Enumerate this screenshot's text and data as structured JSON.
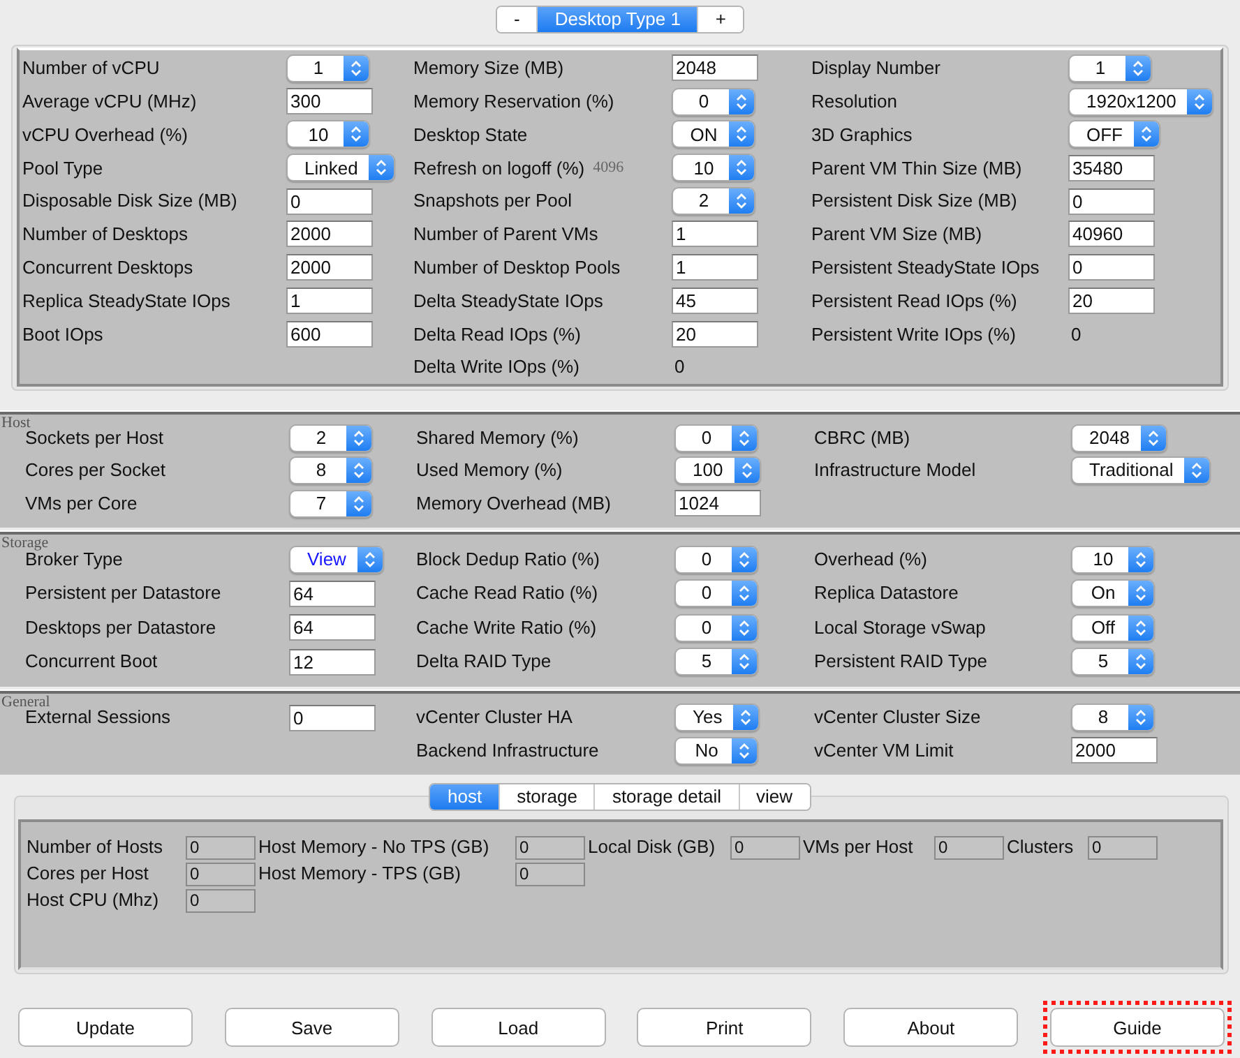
{
  "desktop_tabs": [
    {
      "label": "-",
      "selected": false
    },
    {
      "label": "Desktop Type 1",
      "selected": true
    },
    {
      "label": "+",
      "selected": false
    }
  ],
  "desktop_type": {
    "columns": [
      [
        {
          "label": "Number of vCPU",
          "kind": "select",
          "value": "1"
        },
        {
          "label": "Average vCPU (MHz)",
          "kind": "text",
          "value": "300"
        },
        {
          "label": "vCPU Overhead (%)",
          "kind": "select",
          "value": "10"
        },
        {
          "label": "Pool Type",
          "kind": "select",
          "value": "Linked"
        },
        {
          "label": "Disposable Disk Size (MB)",
          "kind": "text",
          "value": "0"
        },
        {
          "label": "Number of Desktops",
          "kind": "text",
          "value": "2000"
        },
        {
          "label": "Concurrent Desktops",
          "kind": "text",
          "value": "2000"
        },
        {
          "label": "Replica SteadyState IOps",
          "kind": "text",
          "value": "1"
        },
        {
          "label": "Boot IOps",
          "kind": "text",
          "value": "600"
        }
      ],
      [
        {
          "label": "Memory Size (MB)",
          "kind": "text",
          "value": "2048"
        },
        {
          "label": "Memory Reservation (%)",
          "kind": "select",
          "value": "0"
        },
        {
          "label": "Desktop State",
          "kind": "select",
          "value": "ON"
        },
        {
          "label": "Refresh on logoff (%)",
          "kind": "select",
          "value": "10",
          "note": "4096"
        },
        {
          "label": "Snapshots per Pool",
          "kind": "select",
          "value": "2"
        },
        {
          "label": "Number of Parent VMs",
          "kind": "text",
          "value": "1"
        },
        {
          "label": "Number of Desktop Pools",
          "kind": "text",
          "value": "1"
        },
        {
          "label": "Delta SteadyState IOps",
          "kind": "text",
          "value": "45"
        },
        {
          "label": "Delta Read IOps (%)",
          "kind": "text",
          "value": "20"
        },
        {
          "label": "Delta Write IOps (%)",
          "kind": "readout",
          "value": "0"
        }
      ],
      [
        {
          "label": "Display Number",
          "kind": "select",
          "value": "1"
        },
        {
          "label": "Resolution",
          "kind": "select",
          "value": "1920x1200"
        },
        {
          "label": "3D Graphics",
          "kind": "select",
          "value": "OFF"
        },
        {
          "label": "Parent VM Thin Size (MB)",
          "kind": "text",
          "value": "35480"
        },
        {
          "label": "Persistent Disk Size (MB)",
          "kind": "text",
          "value": "0"
        },
        {
          "label": "Parent VM Size (MB)",
          "kind": "text",
          "value": "40960"
        },
        {
          "label": "Persistent SteadyState IOps",
          "kind": "text",
          "value": "0"
        },
        {
          "label": "Persistent Read IOps (%)",
          "kind": "text",
          "value": "20"
        },
        {
          "label": "Persistent Write IOps (%)",
          "kind": "readout",
          "value": "0"
        }
      ]
    ]
  },
  "sections": [
    {
      "title": "Host",
      "columns": [
        [
          {
            "label": "Sockets per Host",
            "kind": "select",
            "value": "2"
          },
          {
            "label": "Cores per Socket",
            "kind": "select",
            "value": "8"
          },
          {
            "label": "VMs per Core",
            "kind": "select",
            "value": "7"
          }
        ],
        [
          {
            "label": "Shared Memory (%)",
            "kind": "select",
            "value": "0"
          },
          {
            "label": "Used Memory (%)",
            "kind": "select",
            "value": "100"
          },
          {
            "label": "Memory Overhead (MB)",
            "kind": "text",
            "value": "1024"
          }
        ],
        [
          {
            "label": "CBRC (MB)",
            "kind": "select",
            "value": "2048"
          },
          {
            "label": "Infrastructure Model",
            "kind": "select",
            "value": "Traditional"
          }
        ]
      ]
    },
    {
      "title": "Storage",
      "columns": [
        [
          {
            "label": "Broker Type",
            "kind": "select",
            "value": "View",
            "focused": true
          },
          {
            "label": "Persistent per Datastore",
            "kind": "text",
            "value": "64"
          },
          {
            "label": "Desktops per Datastore",
            "kind": "text",
            "value": "64"
          },
          {
            "label": "Concurrent Boot",
            "kind": "text",
            "value": "12"
          }
        ],
        [
          {
            "label": "Block Dedup Ratio (%)",
            "kind": "select",
            "value": "0"
          },
          {
            "label": "Cache Read Ratio (%)",
            "kind": "select",
            "value": "0"
          },
          {
            "label": "Cache Write Ratio (%)",
            "kind": "select",
            "value": "0"
          },
          {
            "label": "Delta RAID Type",
            "kind": "select",
            "value": "5"
          }
        ],
        [
          {
            "label": "Overhead (%)",
            "kind": "select",
            "value": "10"
          },
          {
            "label": "Replica Datastore",
            "kind": "select",
            "value": "On"
          },
          {
            "label": "Local Storage vSwap",
            "kind": "select",
            "value": "Off"
          },
          {
            "label": "Persistent RAID Type",
            "kind": "select",
            "value": "5"
          }
        ]
      ]
    },
    {
      "title": "General",
      "columns": [
        [
          {
            "label": "External Sessions",
            "kind": "text",
            "value": "0"
          }
        ],
        [
          {
            "label": "vCenter Cluster HA",
            "kind": "select",
            "value": "Yes"
          },
          {
            "label": "Backend Infrastructure",
            "kind": "select",
            "value": "No"
          }
        ],
        [
          {
            "label": "vCenter Cluster Size",
            "kind": "select",
            "value": "8"
          },
          {
            "label": "vCenter VM Limit",
            "kind": "text",
            "value": "2000"
          }
        ]
      ]
    }
  ],
  "result_tabs": [
    {
      "label": "host",
      "selected": true
    },
    {
      "label": "storage",
      "selected": false
    },
    {
      "label": "storage detail",
      "selected": false
    },
    {
      "label": "view",
      "selected": false
    }
  ],
  "results": {
    "rows": [
      [
        {
          "label": "Number of Hosts",
          "value": "0"
        },
        {
          "label": "Host Memory - No TPS (GB)",
          "value": "0"
        },
        {
          "label": "Local Disk (GB)",
          "value": "0"
        },
        {
          "label": "VMs per Host",
          "value": "0"
        },
        {
          "label": "Clusters",
          "value": "0"
        }
      ],
      [
        {
          "label": "Cores per Host",
          "value": "0"
        },
        {
          "label": "Host Memory - TPS (GB)",
          "value": "0"
        }
      ],
      [
        {
          "label": "Host CPU (Mhz)",
          "value": "0"
        }
      ]
    ]
  },
  "buttons": [
    {
      "label": "Update",
      "highlighted": false
    },
    {
      "label": "Save",
      "highlighted": false
    },
    {
      "label": "Load",
      "highlighted": false
    },
    {
      "label": "Print",
      "highlighted": false
    },
    {
      "label": "About",
      "highlighted": false
    },
    {
      "label": "Guide",
      "highlighted": true
    }
  ]
}
